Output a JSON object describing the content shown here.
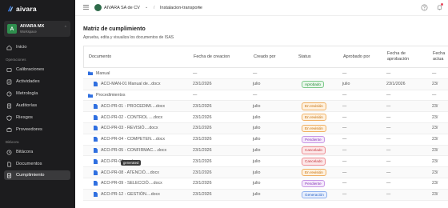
{
  "app": {
    "name": "aivara"
  },
  "workspace": {
    "initial": "A",
    "name": "AIVARA MX",
    "subtitle": "Workspace"
  },
  "sidebar": {
    "items_top": [
      {
        "label": "Inicio",
        "icon": "home-icon"
      }
    ],
    "section_ops": "Operaciones",
    "items_ops": [
      {
        "label": "Calibraciones",
        "icon": "calibration-icon"
      },
      {
        "label": "Actividades",
        "icon": "activity-icon"
      },
      {
        "label": "Metrología",
        "icon": "metrology-icon"
      },
      {
        "label": "Auditorías",
        "icon": "audit-icon"
      },
      {
        "label": "Riesgos",
        "icon": "risk-icon"
      },
      {
        "label": "Proveedores",
        "icon": "supplier-icon"
      }
    ],
    "section_bitacora": "Bitácora",
    "items_bitacora": [
      {
        "label": "Bitácora",
        "icon": "logbook-icon"
      },
      {
        "label": "Documentos",
        "icon": "documents-icon"
      },
      {
        "label": "Cumplimiento",
        "icon": "compliance-icon",
        "active": true
      }
    ]
  },
  "header": {
    "org": "AIVARA SA de CV",
    "separator": "/",
    "project": "Instalacion-transporte"
  },
  "main": {
    "title": "Matriz de cumplimiento",
    "subtitle": "Aprueba, edita y visualiza los documentos de ISAS",
    "columns": [
      "Documento",
      "Fecha de creacion",
      "Creado por",
      "Status",
      "Aprobado por",
      "Fecha de aprobación",
      "Fecha actua"
    ],
    "rows": [
      {
        "type": "folder",
        "doc": "Manual",
        "created": "—",
        "by": "—",
        "status": "",
        "approved_by": "—",
        "approved_at": "—",
        "updated": "—"
      },
      {
        "type": "file",
        "doc": "ACO-MAN-01 Manual de...docx",
        "created": "23/1/2026",
        "by": "julio",
        "status": "Aprobado",
        "badge": "green",
        "approved_by": "julio",
        "approved_at": "23/1/2026",
        "updated": "23/"
      },
      {
        "type": "folder",
        "doc": "Procedimientos",
        "created": "—",
        "by": "—",
        "status": "",
        "approved_by": "—",
        "approved_at": "—",
        "updated": "—"
      },
      {
        "type": "file",
        "doc": "ACO-PR-01 - PROCEDIMI....docx",
        "created": "23/1/2026",
        "by": "julio",
        "status": "En revisión",
        "badge": "orange",
        "approved_by": "—",
        "approved_at": "—",
        "updated": "23/"
      },
      {
        "type": "file",
        "doc": "ACO-PR-02 - CONTROL ....docx",
        "created": "23/1/2026",
        "by": "julio",
        "status": "En revisión",
        "badge": "orange",
        "approved_by": "—",
        "approved_at": "—",
        "updated": "23/"
      },
      {
        "type": "file",
        "doc": "ACO-PR-03 - REVISIÓ....docx",
        "created": "23/1/2026",
        "by": "julio",
        "status": "En revisión",
        "badge": "orange",
        "approved_by": "—",
        "approved_at": "—",
        "updated": "23/"
      },
      {
        "type": "file",
        "doc": "ACO-PR-04 - COMPETEN....docx",
        "created": "23/1/2026",
        "by": "julio",
        "status": "Pendiente",
        "badge": "purple",
        "approved_by": "—",
        "approved_at": "—",
        "updated": "23/"
      },
      {
        "type": "file",
        "doc": "ACO-PR-05 - CONFIRMAC....docx",
        "created": "23/1/2026",
        "by": "julio",
        "status": "Cancelado",
        "badge": "red",
        "approved_by": "—",
        "approved_at": "—",
        "updated": "23/"
      },
      {
        "type": "file",
        "doc": "ACO-PR-07 - ...docx",
        "created": "23/1/2026",
        "by": "julio",
        "status": "Cancelado",
        "badge": "red",
        "approved_by": "—",
        "approved_at": "—",
        "updated": "23/"
      },
      {
        "type": "file",
        "doc": "ACO-PR-08 - ATENCIÓ....docx",
        "created": "23/1/2026",
        "by": "julio",
        "status": "En revisión",
        "badge": "orange",
        "approved_by": "—",
        "approved_at": "—",
        "updated": "23/"
      },
      {
        "type": "file",
        "doc": "ACO-PR-09 - SELECCIÓ....docx",
        "created": "23/1/2026",
        "by": "julio",
        "status": "Pendiente",
        "badge": "purple",
        "approved_by": "—",
        "approved_at": "—",
        "updated": "23/"
      },
      {
        "type": "file",
        "doc": "ACO-PR-12 - GESTIÓN....docx",
        "created": "23/1/2026",
        "by": "julio",
        "status": "Generación",
        "badge": "blue",
        "approved_by": "—",
        "approved_at": "—",
        "updated": "23/"
      }
    ],
    "tooltip": "generated"
  },
  "colors": {
    "sidebar_bg": "#1c1c1e",
    "accent": "#2f6fe0",
    "active_nav": "#3a3a3c"
  }
}
